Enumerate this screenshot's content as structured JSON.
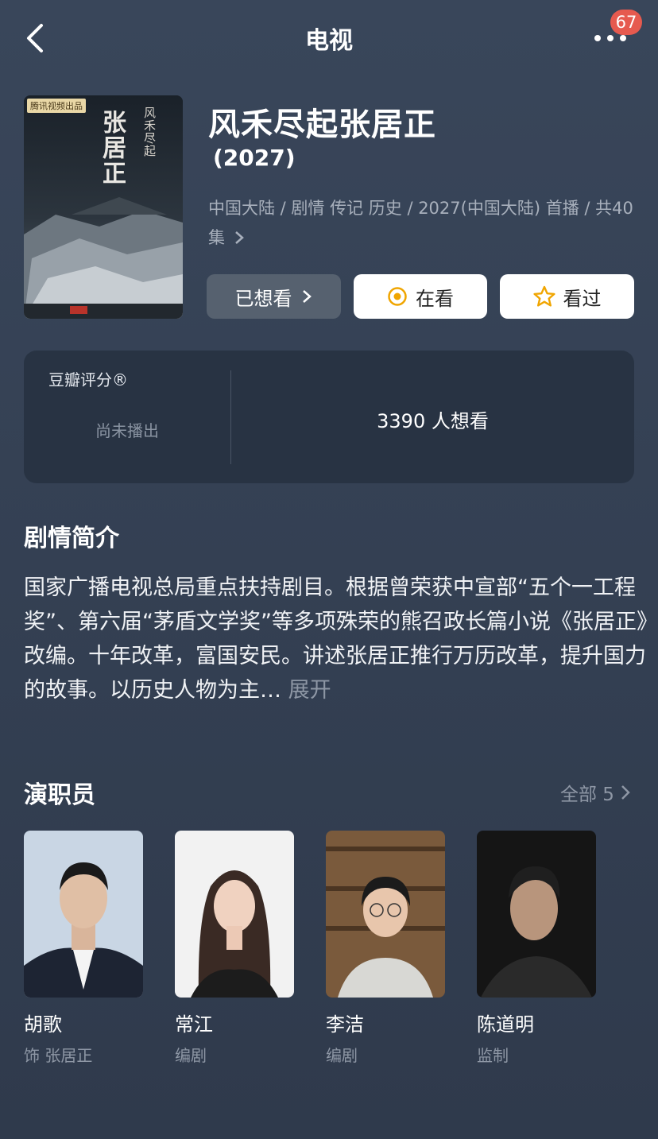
{
  "header": {
    "title": "电视",
    "badge_count": "67"
  },
  "poster": {
    "tag": "腾讯视频出品",
    "title": "张居正",
    "subtitle": "风禾尽起"
  },
  "show": {
    "title": "风禾尽起张居正",
    "year": "(2027)",
    "meta": "中国大陆 / 剧情 传记 历史 / 2027(中国大陆) 首播 / 共40集"
  },
  "actions": {
    "want_label": "已想看",
    "watching_label": "在看",
    "watched_label": "看过"
  },
  "rating": {
    "label": "豆瓣评分®",
    "status": "尚未播出",
    "want_count": "3390 人想看"
  },
  "synopsis": {
    "title": "剧情简介",
    "text": "国家广播电视总局重点扶持剧目。根据曾荣获中宣部“五个一工程奖”、第六届“茅盾文学奖”等多项殊荣的熊召政长篇小说《张居正》改编。十年改革，富国安民。讲述张居正推行万历改革，提升国力的故事。以历史人物为主…",
    "expand": "展开"
  },
  "cast": {
    "title": "演职员",
    "all_label": "全部 5",
    "members": [
      {
        "name": "胡歌",
        "role": "饰 张居正"
      },
      {
        "name": "常江",
        "role": "编剧"
      },
      {
        "name": "李洁",
        "role": "编剧"
      },
      {
        "name": "陈道明",
        "role": "监制"
      }
    ]
  },
  "colors": {
    "background": "#39465a",
    "card": "#283343",
    "badge": "#e65a4f",
    "accent": "#f0a500",
    "muted": "#8e97a5"
  }
}
